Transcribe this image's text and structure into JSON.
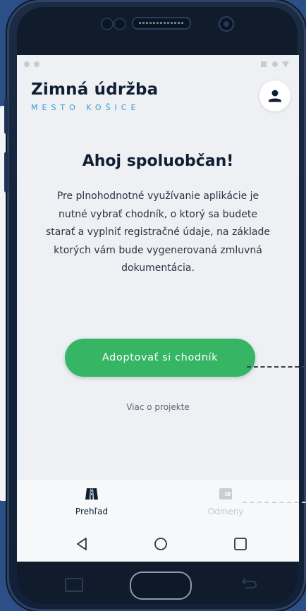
{
  "app": {
    "title": "Zimná údržba",
    "subtitle": "MESTO KOŠICE"
  },
  "main": {
    "greeting": "Ahoj spoluobčan!",
    "intro": "Pre plnohodnotné využívanie aplikácie je nutné vybrať chodník, o ktorý sa budete starať a vyplniť registračné údaje, na základe ktorých vám bude vygenerovaná zmluvná dokumentácia.",
    "cta_label": "Adoptovať si chodník",
    "more_link": "Viac o projekte"
  },
  "bottom_nav": {
    "items": [
      {
        "label": "Prehľad",
        "icon": "road-icon",
        "active": true
      },
      {
        "label": "Odmeny",
        "icon": "wallet-icon",
        "active": false
      }
    ]
  },
  "colors": {
    "accent": "#36b565",
    "subtitle": "#2ba0d8",
    "title": "#101e34",
    "background": "#2b4f86"
  }
}
